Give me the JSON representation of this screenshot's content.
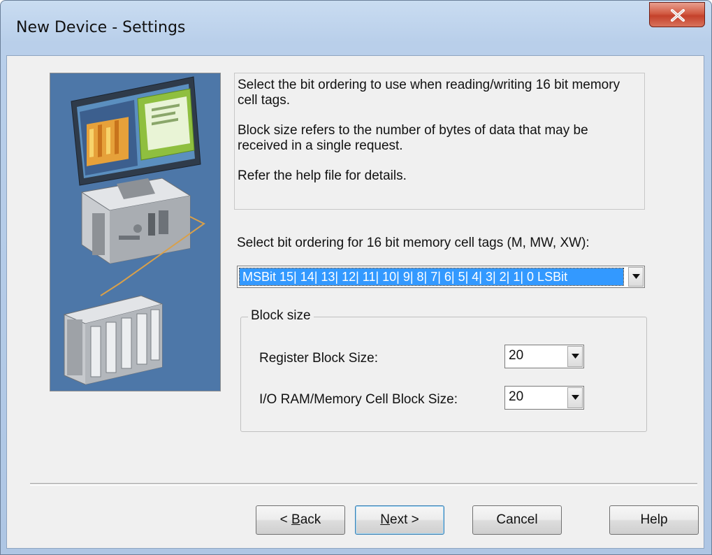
{
  "window": {
    "title": "New Device - Settings"
  },
  "description": {
    "paragraph1": "Select the bit ordering to use when reading/writing 16 bit memory cell tags.",
    "paragraph2": "Block size refers to the number of bytes of data that may be received in a single request.",
    "paragraph3": "Refer the help file for details."
  },
  "bit_ordering": {
    "label": "Select bit ordering for 16 bit memory cell tags (M, MW, XW):",
    "selected": "MSBit 15| 14| 13| 12| 11| 10| 9| 8| 7| 6| 5| 4| 3| 2| 1| 0 LSBit"
  },
  "block_size": {
    "group_label": "Block size",
    "register_label": "Register Block Size:",
    "register_value": "20",
    "io_label": "I/O RAM/Memory Cell Block Size:",
    "io_value": "20"
  },
  "buttons": {
    "back_mnemonic": "B",
    "back_prefix": "< ",
    "back_rest": "ack",
    "next_mnemonic": "N",
    "next_rest": "ext >",
    "cancel": "Cancel",
    "help": "Help"
  },
  "colors": {
    "selection": "#3399ff",
    "illustration_bg": "#4d77a8",
    "close_button": "#c4412b"
  },
  "icons": {
    "close": "close-x-icon",
    "dropdown": "chevron-down-icon",
    "illustration": "computer-plc-illustration"
  }
}
